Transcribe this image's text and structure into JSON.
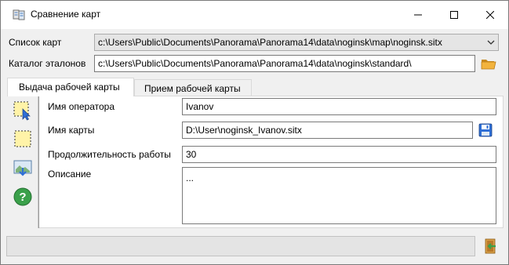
{
  "window": {
    "title": "Сравнение карт",
    "icons": {
      "app": "compare-maps-icon",
      "minimize": "minimize-icon",
      "maximize": "maximize-icon",
      "close": "close-icon"
    }
  },
  "map_list": {
    "label": "Список карт",
    "value": "c:\\Users\\Public\\Documents\\Panorama\\Panorama14\\data\\noginsk\\map\\noginsk.sitx",
    "icon": "chevron-down-icon"
  },
  "standards_catalog": {
    "label": "Каталог эталонов",
    "value": "c:\\Users\\Public\\Documents\\Panorama\\Panorama14\\data\\noginsk\\standard\\",
    "icon": "folder-open-icon"
  },
  "tabs": [
    {
      "label": "Выдача рабочей карты",
      "active": true
    },
    {
      "label": "Прием рабочей карты",
      "active": false
    }
  ],
  "toolbar": {
    "tools": [
      {
        "icon": "select-area-icon"
      },
      {
        "icon": "rectangle-frame-icon"
      },
      {
        "icon": "export-map-icon"
      },
      {
        "icon": "help-icon"
      }
    ]
  },
  "form": {
    "operator": {
      "label": "Имя оператора",
      "value": "Ivanov"
    },
    "map_name": {
      "label": "Имя карты",
      "value": "D:\\User\\noginsk_Ivanov.sitx",
      "icon": "save-icon"
    },
    "duration": {
      "label": "Продолжительность работы",
      "value": "30"
    },
    "description": {
      "label": "Описание",
      "value": "..."
    }
  },
  "status": {
    "text": "",
    "exit_icon": "exit-door-icon"
  },
  "colors": {
    "accent_blue": "#2f6fd6",
    "folder_orange": "#e8a23a",
    "help_green": "#3aa04a"
  }
}
